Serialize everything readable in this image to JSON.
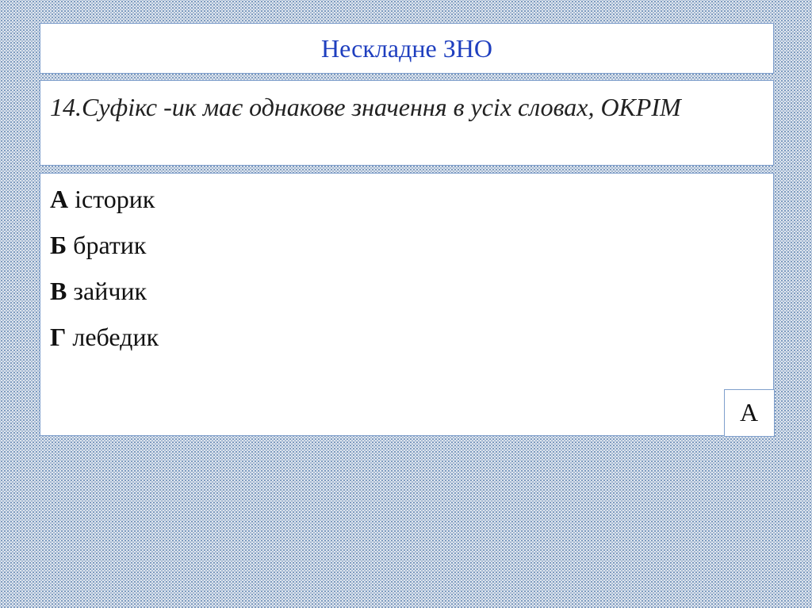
{
  "slide": {
    "title": "Нескладне ЗНО",
    "question": "14.Суфікс -ик має однакове значення в усіх словах, ОКРІМ",
    "options": [
      {
        "letter": "А",
        "text": "історик"
      },
      {
        "letter": "Б",
        "text": "братик"
      },
      {
        "letter": "В",
        "text": "зайчик"
      },
      {
        "letter": "Г",
        "text": "лебедик"
      }
    ],
    "answer": "А"
  },
  "colors": {
    "title_text": "#1f3fbf",
    "box_border": "#7f9fcc",
    "background": "#dfe6ee"
  }
}
